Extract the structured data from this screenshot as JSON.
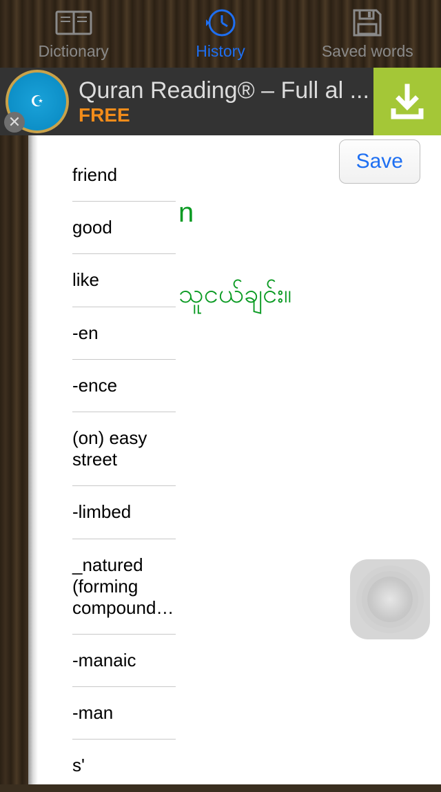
{
  "tabs": {
    "dictionary": "Dictionary",
    "history": "History",
    "saved": "Saved words"
  },
  "ad": {
    "title": "Quran Reading® – Full al ...",
    "subtitle": "FREE"
  },
  "save_button": "Save",
  "part_of_speech": "n",
  "meaning": "သူငယ်ချင်း။",
  "words": [
    "friend",
    "good",
    "like",
    "-en",
    "-ence",
    "(on) easy street",
    "-limbed",
    "_natured (forming compound…",
    "-manaic",
    "-man",
    "s'"
  ]
}
